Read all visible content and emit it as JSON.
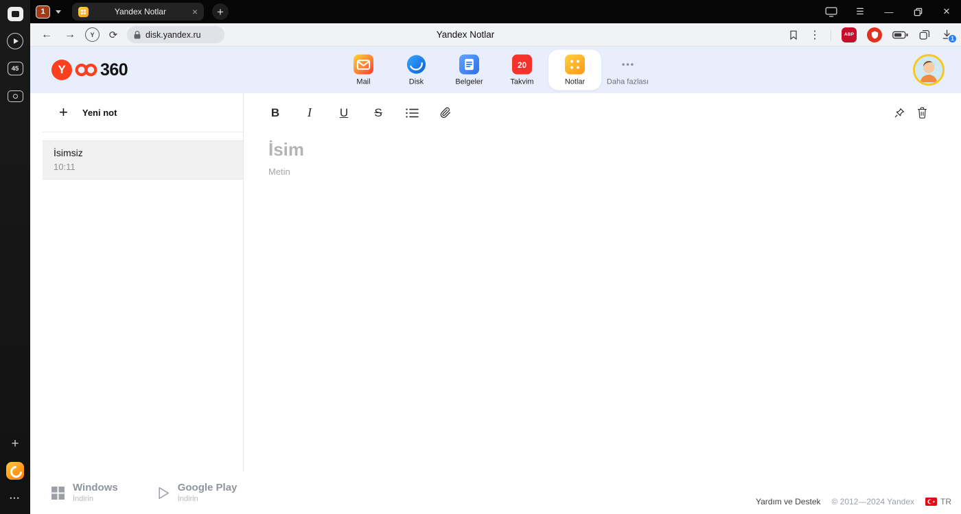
{
  "colors": {
    "yandex_red": "#fb3f1f",
    "header_bg": "#e9eefc",
    "accent_blue": "#2e7cf6",
    "notes_yellow": "#ff9d1f",
    "calendar_red": "#f5322b"
  },
  "icons": {
    "back": "←",
    "forward": "→",
    "reload": "⟳",
    "yandex": "Y",
    "more_vertical": "⋮",
    "menu": "☰",
    "minimize": "—",
    "close": "✕",
    "close_tab": "×",
    "plus": "+",
    "overflow_dots": "•••"
  },
  "browser": {
    "sidebar": {
      "tabs_count": "45"
    },
    "tabbar": {
      "group_badge": "1",
      "active_tab_title": "Yandex Notlar"
    },
    "toolbar": {
      "url": "disk.yandex.ru",
      "page_title": "Yandex Notlar",
      "abp_badge": "ABP",
      "download_badge": "1"
    }
  },
  "header": {
    "logo_y": "Y",
    "logo_suffix": "360",
    "nav": [
      {
        "label": "Mail"
      },
      {
        "label": "Disk"
      },
      {
        "label": "Belgeler"
      },
      {
        "label": "Takvim",
        "badge": "20"
      },
      {
        "label": "Notlar"
      },
      {
        "label": "Daha fazlası"
      }
    ]
  },
  "notes_panel": {
    "new_note_label": "Yeni not",
    "notes": [
      {
        "title": "İsimsiz",
        "time": "10:11"
      }
    ]
  },
  "editor": {
    "toolbar": {
      "bold": "B",
      "italic": "I",
      "underline": "U",
      "strikethrough": "S"
    },
    "title_placeholder": "İsim",
    "body_placeholder": "Metin"
  },
  "footer": {
    "apps": [
      {
        "name": "Windows",
        "action": "İndirin"
      },
      {
        "name": "Google Play",
        "action": "İndirin"
      }
    ],
    "help": "Yardım ve Destek",
    "copyright": "© 2012—2024 Yandex",
    "language": "TR"
  }
}
